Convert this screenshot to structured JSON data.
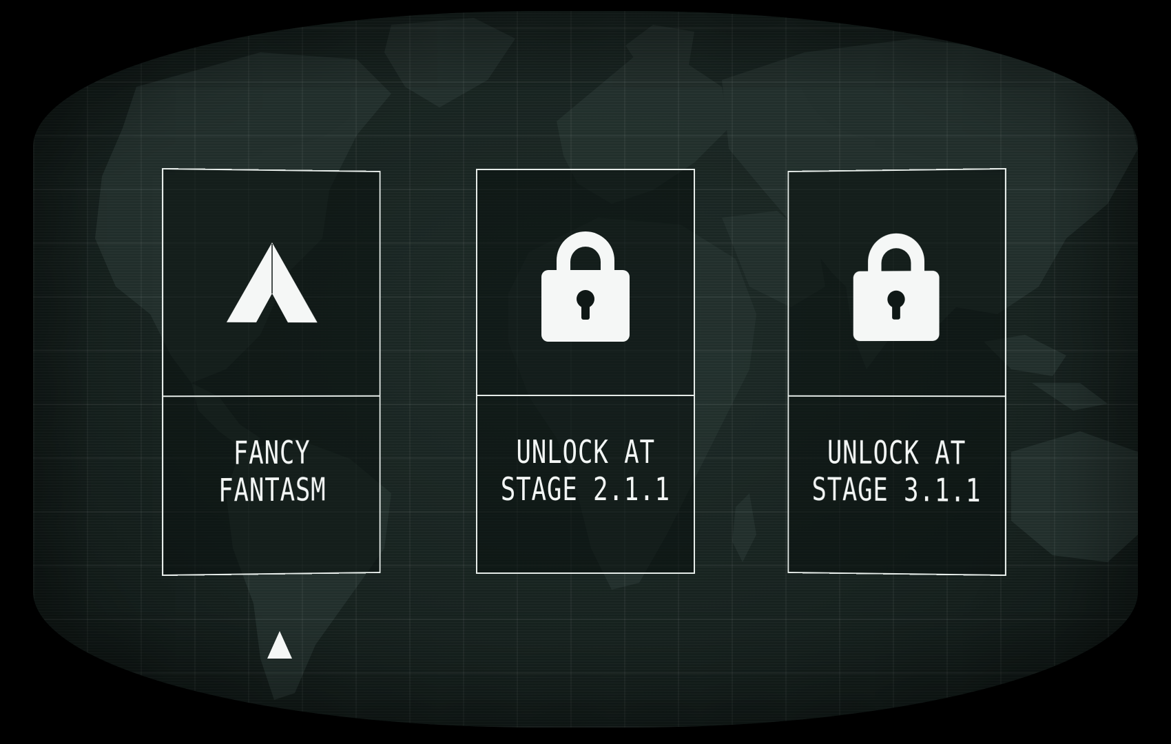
{
  "screen": {
    "background_color": "#000000",
    "crt_color": "#1b2724",
    "line_color": "#e6ece9"
  },
  "cards": [
    {
      "label_line1": "FANCY",
      "label_line2": "FANTASM",
      "icon": "ship-arrow-icon",
      "locked": false
    },
    {
      "label_line1": "UNLOCK AT",
      "label_line2": "STAGE 2.1.1",
      "icon": "padlock-icon",
      "locked": true
    },
    {
      "label_line1": "UNLOCK AT",
      "label_line2": "STAGE 3.1.1",
      "icon": "padlock-icon",
      "locked": true
    }
  ],
  "selector": {
    "icon": "selector-triangle-icon",
    "selected_index": 0
  }
}
